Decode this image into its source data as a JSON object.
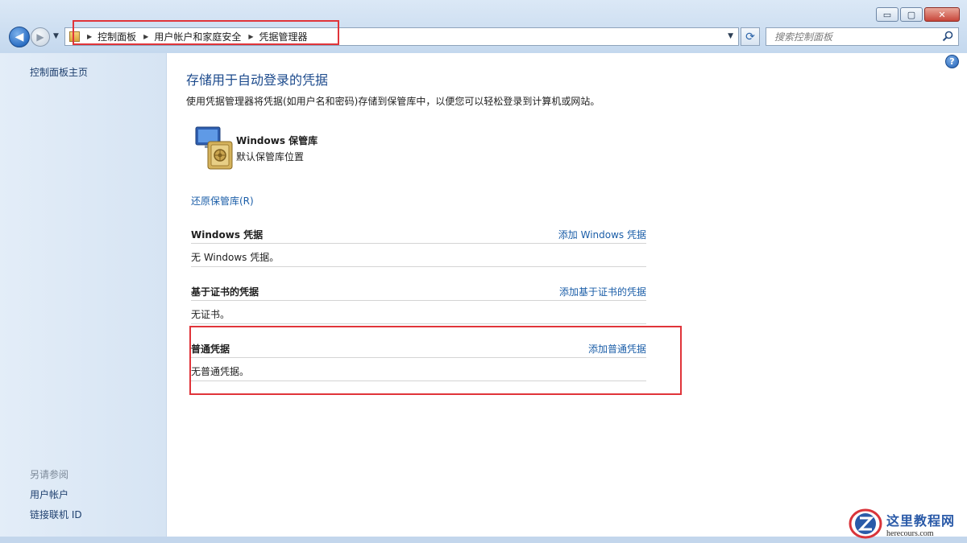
{
  "window": {
    "minimize_glyph": "▭",
    "restore_glyph": "▢",
    "close_glyph": "✕"
  },
  "nav": {
    "back_glyph": "◀",
    "forward_glyph": "▶",
    "dropdown_glyph": "▼"
  },
  "address": {
    "breadcrumbs": [
      "控制面板",
      "用户帐户和家庭安全",
      "凭据管理器"
    ],
    "separator_glyph": "▶",
    "dropdown_glyph": "▼",
    "refresh_glyph": "⟳"
  },
  "search": {
    "placeholder": "搜索控制面板",
    "icon": "search-icon"
  },
  "sidebar": {
    "home_link": "控制面板主页",
    "see_also_label": "另请参阅",
    "see_also_links": [
      "用户帐户",
      "链接联机 ID"
    ]
  },
  "main": {
    "help_glyph": "?",
    "title": "存储用于自动登录的凭据",
    "description": "使用凭据管理器将凭据(如用户名和密码)存储到保管库中，以便您可以轻松登录到计算机或网站。",
    "vault": {
      "name": "Windows 保管库",
      "subtitle": "默认保管库位置",
      "icon": "vault-icon"
    },
    "restore_link": "还原保管库(R)",
    "sections": [
      {
        "title": "Windows 凭据",
        "add_link": "添加 Windows 凭据",
        "empty_text": "无 Windows 凭据。"
      },
      {
        "title": "基于证书的凭据",
        "add_link": "添加基于证书的凭据",
        "empty_text": "无证书。"
      },
      {
        "title": "普通凭据",
        "add_link": "添加普通凭据",
        "empty_text": "无普通凭据。"
      }
    ]
  },
  "watermark": {
    "title": "这里教程网",
    "url": "herecours.com",
    "colors": {
      "primary": "#2a5aa8",
      "accent": "#d9343a"
    }
  },
  "colors": {
    "link": "#1b5ea8",
    "title": "#1c4a8c",
    "highlight_box": "#e0343a",
    "sidebar_bg": "#dde8f5"
  }
}
